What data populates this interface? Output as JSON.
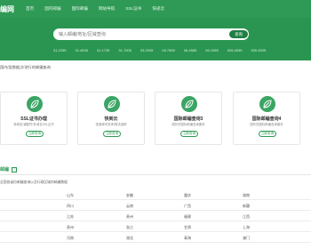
{
  "brand": {
    "logo": "编网"
  },
  "nav": {
    "items": [
      "首页",
      "国内邮编",
      "国际邮编",
      "网站导航",
      "SSL证书",
      "快递云"
    ]
  },
  "hero": {
    "search_placeholder": "输入邮编/地址/区域查询",
    "search_button": "查询",
    "ips": [
      "31.2255",
      "31.4535",
      "31.1735",
      "31.7005",
      "33.2935",
      "06.7565",
      "06.4565",
      "06.1955",
      "926.4535",
      "926.4535"
    ]
  },
  "subtitle": "国内/县数据点/进行的邮编查询",
  "cards": [
    {
      "title": "SSL证书办理",
      "desc": "单域名/通配符/多域名SSL证书",
      "button": "立即查询"
    },
    {
      "title": "快到云",
      "desc": "快递单号查询/物流追踪",
      "button": "立即查询"
    },
    {
      "title": "国际邮编查询3",
      "desc": "国外的国际邮编查询服务",
      "button": "立即查询"
    },
    {
      "title": "国际邮编查询4",
      "desc": "国外的国际邮编查询服务",
      "button": "立即查询"
    }
  ],
  "section": {
    "title": "邮编",
    "desc": "全国各省份邮编查询以及行政区域的邮编数据"
  },
  "table": {
    "rows": [
      [
        "",
        "山东",
        "安徽",
        "重庆",
        "湖南"
      ],
      [
        "",
        "四川",
        "云南",
        "广西",
        "新疆"
      ],
      [
        "",
        "江苏",
        "贵州",
        "福建",
        "江西"
      ],
      [
        "",
        "贵州",
        "浙江",
        "甘肃",
        "上海"
      ],
      [
        "",
        "河南",
        "湖北",
        "青海",
        "澳门"
      ]
    ]
  },
  "colors": {
    "primary": "#2e9a55",
    "hero": "#2a9551"
  }
}
